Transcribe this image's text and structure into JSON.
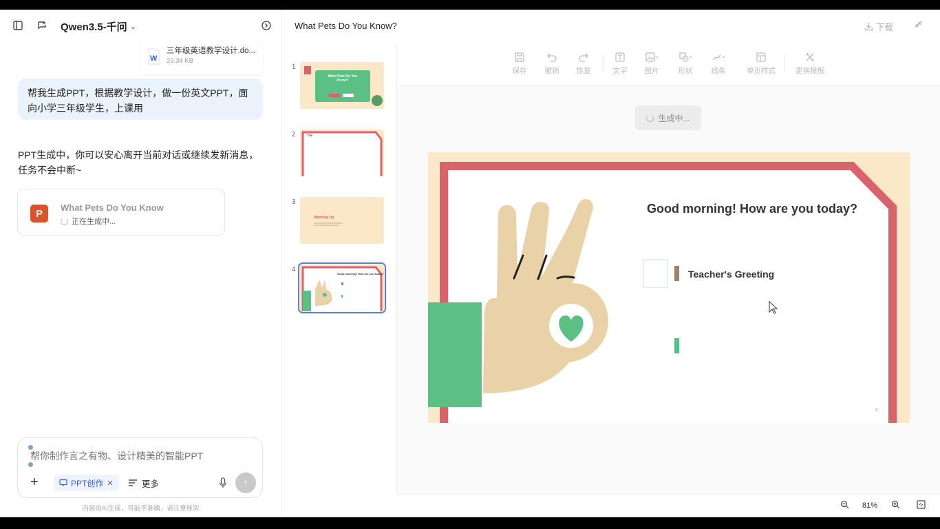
{
  "chat": {
    "model_name": "Qwen3.5-千问",
    "file": {
      "name": "三年级英语教学设计.do...",
      "size": "23.34 KB"
    },
    "user_message": "帮我生成PPT，根据教学设计，做一份英文PPT，面向小学三年级学生，上课用",
    "assistant_message": "PPT生成中，你可以安心离开当前对话或继续发新消息，任务不会中断~",
    "ppt_card": {
      "title": "What Pets Do You Know",
      "status": "正在生成中..."
    },
    "input_placeholder": "帮你制作言之有物、设计精美的智能PPT",
    "mode_chip": "PPT创作",
    "more_label": "更多",
    "disclaimer": "内容由AI生成，可能不准确，请注意核实"
  },
  "editor": {
    "doc_title": "What Pets Do You Know?",
    "download_label": "下载",
    "toolbar": [
      {
        "label": "保存",
        "icon": "save-icon"
      },
      {
        "label": "撤销",
        "icon": "undo-icon"
      },
      {
        "label": "恢复",
        "icon": "redo-icon"
      },
      {
        "label": "文字",
        "icon": "text-icon"
      },
      {
        "label": "图片",
        "icon": "image-icon"
      },
      {
        "label": "形状",
        "icon": "shape-icon"
      },
      {
        "label": "线条",
        "icon": "line-icon"
      },
      {
        "label": "单页样式",
        "icon": "page-style-icon"
      },
      {
        "label": "更换模板",
        "icon": "template-icon"
      }
    ],
    "generating_label": "生成中...",
    "thumbnails": [
      {
        "num": "1",
        "label": "What Pets Do You Know?"
      },
      {
        "num": "2",
        "label": "Title"
      },
      {
        "num": "3",
        "label": "Warming Up"
      },
      {
        "num": "4",
        "label": "Good morning! How are you today?"
      }
    ],
    "slide": {
      "title": "Good morning! How are you today?",
      "item": "Teacher's Greeting",
      "page_number": "4"
    },
    "zoom": "81%"
  },
  "colors": {
    "slide_bg": "#fae8c8",
    "frame_red": "#d9626b",
    "green": "#5cbf84",
    "hand": "#ead2a8",
    "accent_blue": "#3b62d6"
  }
}
